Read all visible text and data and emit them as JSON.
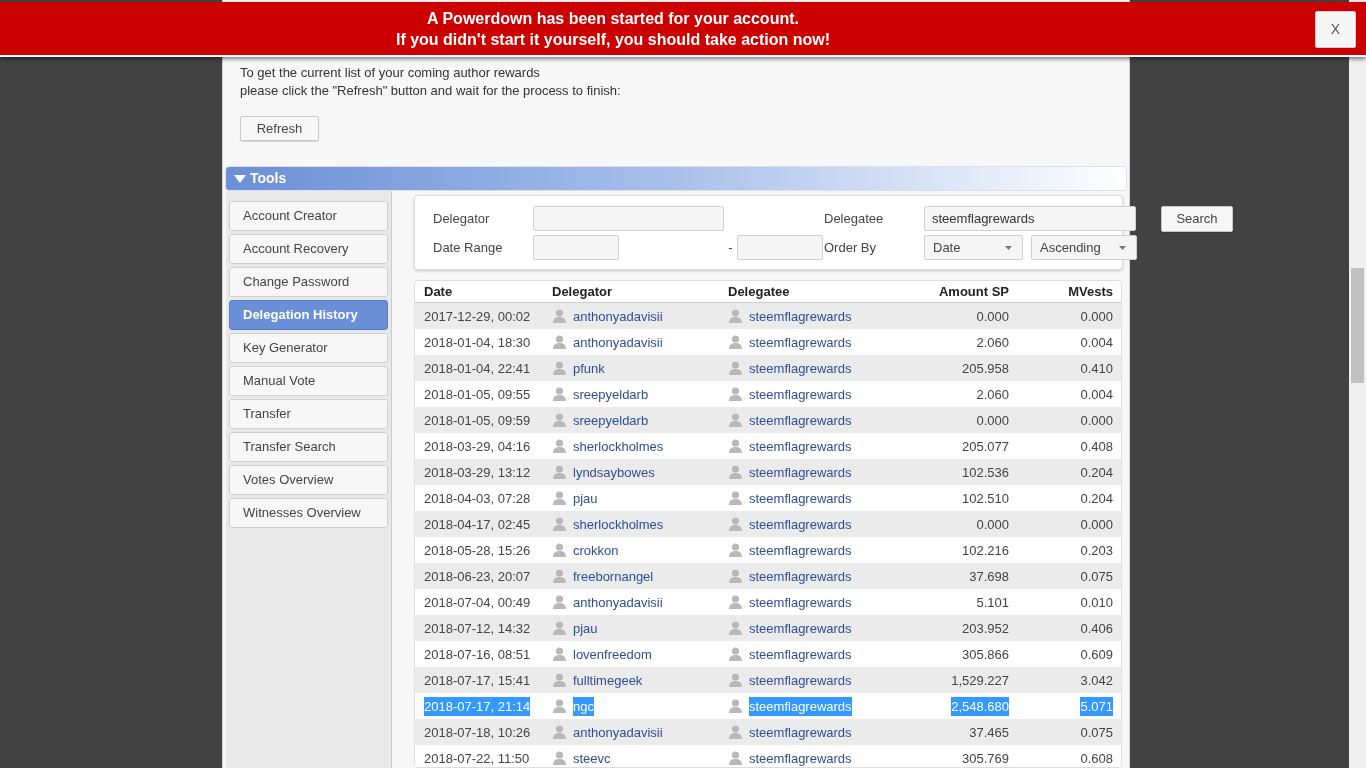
{
  "alert_banner": {
    "lines": [
      "A Powerdown has been started for your account.",
      "If you didn't start it yourself, you should take action now!"
    ],
    "close_button": "X"
  },
  "intro": {
    "lines": [
      "To get the current list of your coming author rewards",
      "please click the \"Refresh\" button and wait for the process to finish:"
    ],
    "button": "Refresh"
  },
  "tools_section": {
    "title": "Tools",
    "expanded": true
  },
  "sidebar": {
    "items": [
      {
        "label": "Account Creator",
        "selected": false
      },
      {
        "label": "Account Recovery",
        "selected": false
      },
      {
        "label": "Change Password",
        "selected": false
      },
      {
        "label": "Delegation History",
        "selected": true
      },
      {
        "label": "Key Generator",
        "selected": false
      },
      {
        "label": "Manual Vote",
        "selected": false
      },
      {
        "label": "Transfer",
        "selected": false
      },
      {
        "label": "Transfer Search",
        "selected": false
      },
      {
        "label": "Votes Overview",
        "selected": false
      },
      {
        "label": "Witnesses Overview",
        "selected": false
      }
    ]
  },
  "filter_form": {
    "delegator_label": "Delegator",
    "delegatee_label": "Delegatee",
    "delegatee_value": "steemflagrewards",
    "search_button": "Search",
    "date_range_label": "Date Range",
    "date_range_separator": "-",
    "order_by_label": "Order By",
    "order_by_field": "Date",
    "order_direction": "Ascending"
  },
  "table": {
    "columns": [
      "Date",
      "Delegator",
      "Delegatee",
      "Amount SP",
      "MVests"
    ],
    "rows": [
      {
        "date": "2017-12-29, 00:02",
        "delegator": "anthonyadavisii",
        "delegatee": "steemflagrewards",
        "amount_sp": "0.000",
        "mvests": "0.000",
        "selected": false
      },
      {
        "date": "2018-01-04, 18:30",
        "delegator": "anthonyadavisii",
        "delegatee": "steemflagrewards",
        "amount_sp": "2.060",
        "mvests": "0.004",
        "selected": false
      },
      {
        "date": "2018-01-04, 22:41",
        "delegator": "pfunk",
        "delegatee": "steemflagrewards",
        "amount_sp": "205.958",
        "mvests": "0.410",
        "selected": false
      },
      {
        "date": "2018-01-05, 09:55",
        "delegator": "sreepyeldarb",
        "delegatee": "steemflagrewards",
        "amount_sp": "2.060",
        "mvests": "0.004",
        "selected": false
      },
      {
        "date": "2018-01-05, 09:59",
        "delegator": "sreepyeldarb",
        "delegatee": "steemflagrewards",
        "amount_sp": "0.000",
        "mvests": "0.000",
        "selected": false
      },
      {
        "date": "2018-03-29, 04:16",
        "delegator": "sherlockholmes",
        "delegatee": "steemflagrewards",
        "amount_sp": "205.077",
        "mvests": "0.408",
        "selected": false
      },
      {
        "date": "2018-03-29, 13:12",
        "delegator": "lyndsaybowes",
        "delegatee": "steemflagrewards",
        "amount_sp": "102.536",
        "mvests": "0.204",
        "selected": false
      },
      {
        "date": "2018-04-03, 07:28",
        "delegator": "pjau",
        "delegatee": "steemflagrewards",
        "amount_sp": "102.510",
        "mvests": "0.204",
        "selected": false
      },
      {
        "date": "2018-04-17, 02:45",
        "delegator": "sherlockholmes",
        "delegatee": "steemflagrewards",
        "amount_sp": "0.000",
        "mvests": "0.000",
        "selected": false
      },
      {
        "date": "2018-05-28, 15:26",
        "delegator": "crokkon",
        "delegatee": "steemflagrewards",
        "amount_sp": "102.216",
        "mvests": "0.203",
        "selected": false
      },
      {
        "date": "2018-06-23, 20:07",
        "delegator": "freebornangel",
        "delegatee": "steemflagrewards",
        "amount_sp": "37.698",
        "mvests": "0.075",
        "selected": false
      },
      {
        "date": "2018-07-04, 00:49",
        "delegator": "anthonyadavisii",
        "delegatee": "steemflagrewards",
        "amount_sp": "5.101",
        "mvests": "0.010",
        "selected": false
      },
      {
        "date": "2018-07-12, 14:32",
        "delegator": "pjau",
        "delegatee": "steemflagrewards",
        "amount_sp": "203.952",
        "mvests": "0.406",
        "selected": false
      },
      {
        "date": "2018-07-16, 08:51",
        "delegator": "lovenfreedom",
        "delegatee": "steemflagrewards",
        "amount_sp": "305.866",
        "mvests": "0.609",
        "selected": false
      },
      {
        "date": "2018-07-17, 15:41",
        "delegator": "fulltimegeek",
        "delegatee": "steemflagrewards",
        "amount_sp": "1,529.227",
        "mvests": "3.042",
        "selected": false
      },
      {
        "date": "2018-07-17, 21:14",
        "delegator": "ngc",
        "delegatee": "steemflagrewards",
        "amount_sp": "2,548.680",
        "mvests": "5.071",
        "selected": true
      },
      {
        "date": "2018-07-18, 10:26",
        "delegator": "anthonyadavisii",
        "delegatee": "steemflagrewards",
        "amount_sp": "37.465",
        "mvests": "0.075",
        "selected": false
      },
      {
        "date": "2018-07-22, 11:50",
        "delegator": "steevc",
        "delegatee": "steemflagrewards",
        "amount_sp": "305.769",
        "mvests": "0.608",
        "selected": false
      }
    ]
  }
}
